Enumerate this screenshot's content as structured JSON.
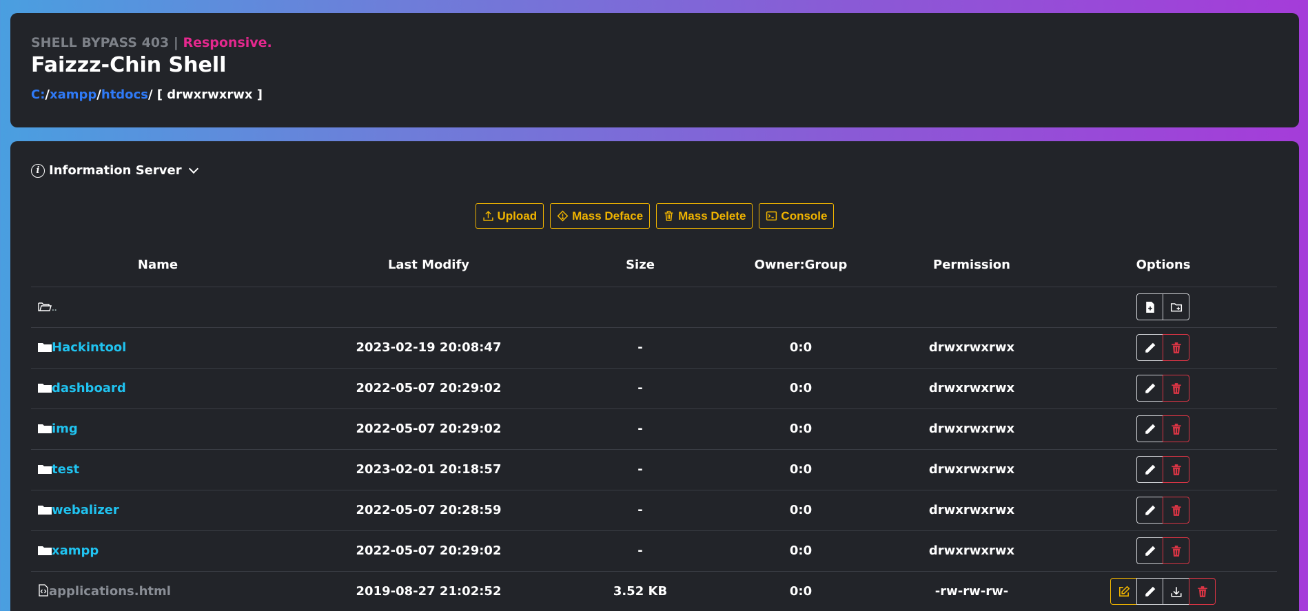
{
  "header": {
    "subtitle": "SHELL BYPASS 403 |",
    "subtitle_accent": "Responsive.",
    "title": "Faizzz-Chin Shell",
    "path": [
      {
        "label": "C:"
      },
      {
        "label": "xampp"
      },
      {
        "label": "htdocs"
      }
    ],
    "path_perm": "/ [ drwxrwxrwx ]"
  },
  "info": {
    "label": "Information Server"
  },
  "toolbar": {
    "upload": "Upload",
    "mass_deface": "Mass Deface",
    "mass_delete": "Mass Delete",
    "console": "Console"
  },
  "table": {
    "headers": [
      "Name",
      "Last Modify",
      "Size",
      "Owner:Group",
      "Permission",
      "Options"
    ],
    "parent_label": "..",
    "rows": [
      {
        "name": "Hackintool",
        "type": "dir",
        "modified": "2023-02-19 20:08:47",
        "size": "-",
        "owner": "0:0",
        "perm": "drwxrwxrwx"
      },
      {
        "name": "dashboard",
        "type": "dir",
        "modified": "2022-05-07 20:29:02",
        "size": "-",
        "owner": "0:0",
        "perm": "drwxrwxrwx"
      },
      {
        "name": "img",
        "type": "dir",
        "modified": "2022-05-07 20:29:02",
        "size": "-",
        "owner": "0:0",
        "perm": "drwxrwxrwx"
      },
      {
        "name": "test",
        "type": "dir",
        "modified": "2023-02-01 20:18:57",
        "size": "-",
        "owner": "0:0",
        "perm": "drwxrwxrwx"
      },
      {
        "name": "webalizer",
        "type": "dir",
        "modified": "2022-05-07 20:28:59",
        "size": "-",
        "owner": "0:0",
        "perm": "drwxrwxrwx"
      },
      {
        "name": "xampp",
        "type": "dir",
        "modified": "2022-05-07 20:29:02",
        "size": "-",
        "owner": "0:0",
        "perm": "drwxrwxrwx"
      },
      {
        "name": "applications.html",
        "type": "file",
        "modified": "2019-08-27 21:02:52",
        "size": "3.52 KB",
        "owner": "0:0",
        "perm": "-rw-rw-rw-"
      }
    ]
  },
  "colors": {
    "accent_yellow": "#f0b400",
    "link_blue": "#2f7af7",
    "folder_cyan": "#20c3f0",
    "danger_red": "#dc3545",
    "pink": "#e5288e"
  }
}
